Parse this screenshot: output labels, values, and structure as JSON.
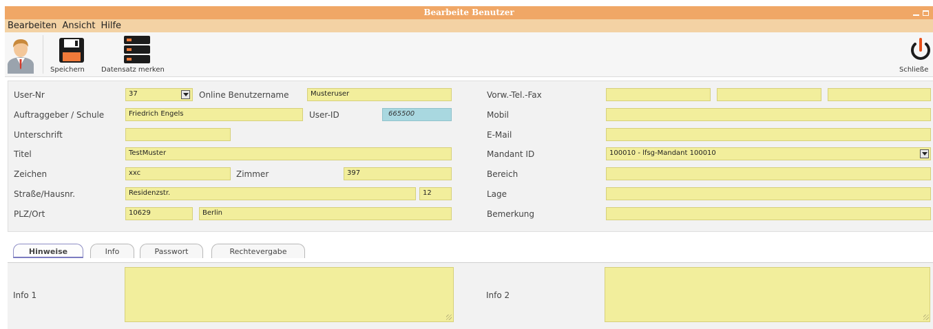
{
  "window": {
    "title": "Bearbeite Benutzer"
  },
  "menu": {
    "items": [
      "Bearbeiten",
      "Ansicht",
      "Hilfe"
    ]
  },
  "toolbar": {
    "save_label": "Speichern",
    "bookmark_label": "Datensatz merken",
    "close_label": "Schließe"
  },
  "form": {
    "left": {
      "user_nr": {
        "label": "User-Nr",
        "value": "37"
      },
      "online_username": {
        "label": "Online Benutzername",
        "value": "Musteruser"
      },
      "auftraggeber": {
        "label": "Auftraggeber / Schule",
        "value": "Friedrich Engels"
      },
      "user_id": {
        "label": "User-ID",
        "value": "665500"
      },
      "unterschrift": {
        "label": "Unterschrift",
        "value": ""
      },
      "titel": {
        "label": "Titel",
        "value": "TestMuster"
      },
      "zeichen": {
        "label": "Zeichen",
        "value": "xxc"
      },
      "zimmer": {
        "label": "Zimmer",
        "value": "397"
      },
      "strasse": {
        "label": "Straße/Hausnr.",
        "value": "Residenzstr.",
        "hausnr": "12"
      },
      "plz_ort": {
        "label": "PLZ/Ort",
        "plz": "10629",
        "ort": "Berlin"
      }
    },
    "right": {
      "tel_fax": {
        "label": "Vorw.-Tel.-Fax",
        "vorw": "",
        "tel": "",
        "fax": ""
      },
      "mobil": {
        "label": "Mobil",
        "value": ""
      },
      "email": {
        "label": "E-Mail",
        "value": ""
      },
      "mandant": {
        "label": "Mandant ID",
        "value": "100010 - lfsg-Mandant 100010"
      },
      "bereich": {
        "label": "Bereich",
        "value": ""
      },
      "lage": {
        "label": "Lage",
        "value": ""
      },
      "bemerkung": {
        "label": "Bemerkung",
        "value": ""
      }
    }
  },
  "tabs": [
    {
      "label": "Hinweise",
      "active": true
    },
    {
      "label": "Info",
      "active": false
    },
    {
      "label": "Passwort",
      "active": false
    },
    {
      "label": "Rechtevergabe",
      "active": false
    }
  ],
  "notes": {
    "info1": {
      "label": "Info 1",
      "value": ""
    },
    "info2": {
      "label": "Info 2",
      "value": ""
    }
  },
  "colors": {
    "titlebar": "#f0a766",
    "menubar": "#f3d2a4",
    "field": "#f2ee9c",
    "readonly_field": "#a9d8e0",
    "close_icon": "#e8501a"
  },
  "icons": [
    "user-avatar-icon",
    "floppy-disk-icon",
    "stacked-records-icon",
    "power-icon",
    "dropdown-arrow-icon"
  ]
}
